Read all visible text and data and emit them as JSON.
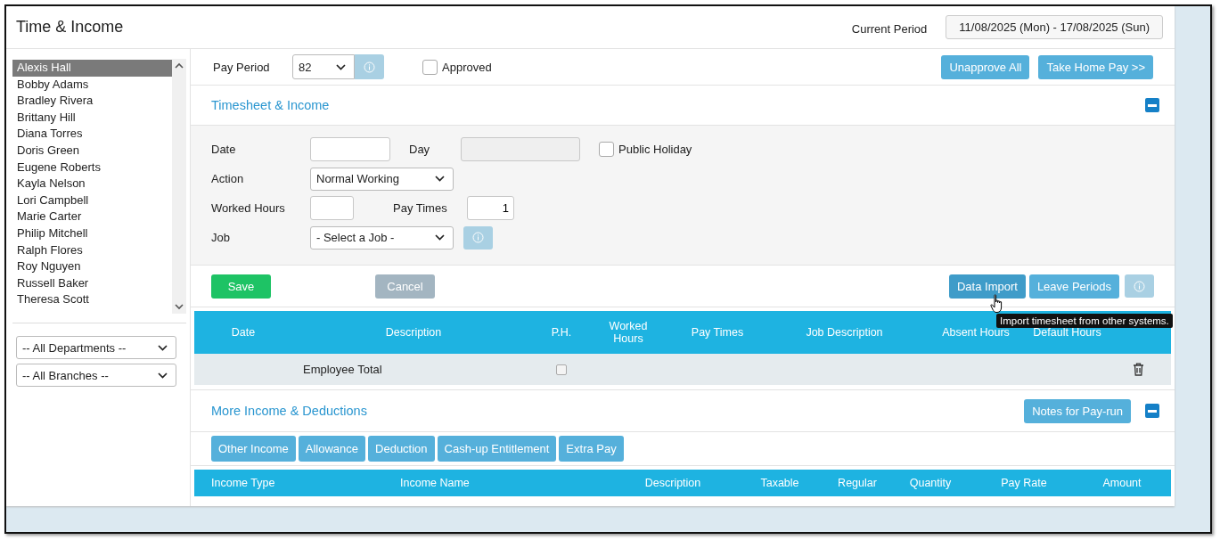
{
  "title": "Time & Income",
  "current_period": {
    "label": "Current Period",
    "value": "11/08/2025 (Mon) - 17/08/2025 (Sun)"
  },
  "employees": [
    {
      "name": "Alexis Hall",
      "selected": true
    },
    {
      "name": "Bobby Adams",
      "selected": false
    },
    {
      "name": "Bradley Rivera",
      "selected": false
    },
    {
      "name": "Brittany Hill",
      "selected": false
    },
    {
      "name": "Diana Torres",
      "selected": false
    },
    {
      "name": "Doris Green",
      "selected": false
    },
    {
      "name": "Eugene Roberts",
      "selected": false
    },
    {
      "name": "Kayla Nelson",
      "selected": false
    },
    {
      "name": "Lori Campbell",
      "selected": false
    },
    {
      "name": "Marie Carter",
      "selected": false
    },
    {
      "name": "Philip Mitchell",
      "selected": false
    },
    {
      "name": "Ralph Flores",
      "selected": false
    },
    {
      "name": "Roy Nguyen",
      "selected": false
    },
    {
      "name": "Russell Baker",
      "selected": false
    },
    {
      "name": "Theresa Scott",
      "selected": false
    }
  ],
  "filters": [
    {
      "value": "-- All Departments --"
    },
    {
      "value": "-- All Branches --"
    }
  ],
  "pay_period": {
    "label": "Pay Period",
    "value": "82",
    "info_disabled": true
  },
  "approved": {
    "label": "Approved",
    "checked": false
  },
  "top_buttons": [
    {
      "label": "Unapprove All"
    },
    {
      "label": "Take Home Pay >>"
    }
  ],
  "timesheet": {
    "title": "Timesheet & Income",
    "date": {
      "label": "Date"
    },
    "day": {
      "label": "Day",
      "disabled": true
    },
    "public_holiday": {
      "label": "Public Holiday",
      "checked": false
    },
    "action": {
      "label": "Action",
      "value": "Normal Working"
    },
    "worked_hours": {
      "label": "Worked Hours"
    },
    "pay_times": {
      "label": "Pay Times",
      "value": "1"
    },
    "job": {
      "label": "Job",
      "value": "- Select a Job -",
      "info_disabled": true
    }
  },
  "form_buttons": [
    {
      "label": "Save",
      "kind": "save"
    },
    {
      "label": "Cancel",
      "kind": "cancel"
    }
  ],
  "tool_buttons": [
    {
      "label": "Data Import",
      "kind": "hover"
    },
    {
      "label": "Leave Periods",
      "kind": "primary"
    }
  ],
  "tool_info_disabled": true,
  "tooltip": "Import timesheet from other systems.",
  "timesheet_table": {
    "columns": [
      "Date",
      "Description",
      "P.H.",
      "Worked Hours",
      "Pay Times",
      "Job Description",
      "Absent Hours",
      "Default Hours"
    ],
    "total_row": {
      "label": "Employee Total",
      "ph_checked": false
    }
  },
  "more": {
    "title": "More Income & Deductions",
    "notes_button": "Notes for Pay-run",
    "tabs": [
      "Other Income",
      "Allowance",
      "Deduction",
      "Cash-up Entitlement",
      "Extra Pay"
    ],
    "columns": [
      "Income Type",
      "Income Name",
      "Description",
      "Taxable",
      "Regular",
      "Quantity",
      "Pay Rate",
      "Amount"
    ]
  }
}
